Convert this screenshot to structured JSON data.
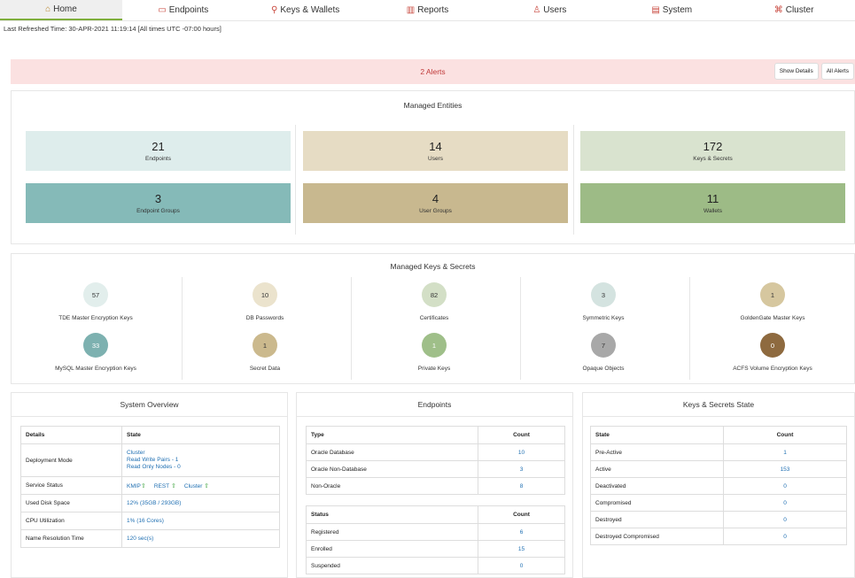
{
  "nav": [
    {
      "icon": "⌂",
      "icon_name": "home-icon",
      "label": "Home",
      "active": true
    },
    {
      "icon": "▭",
      "icon_name": "monitor-icon",
      "label": "Endpoints"
    },
    {
      "icon": "⚲",
      "icon_name": "key-icon",
      "label": "Keys & Wallets"
    },
    {
      "icon": "▥",
      "icon_name": "chart-icon",
      "label": "Reports"
    },
    {
      "icon": "♙",
      "icon_name": "users-icon",
      "label": "Users"
    },
    {
      "icon": "▤",
      "icon_name": "system-icon",
      "label": "System"
    },
    {
      "icon": "⌘",
      "icon_name": "cluster-icon",
      "label": "Cluster"
    }
  ],
  "refresh_text": "Last Refreshed Time: 30-APR-2021 11:19:14 [All times UTC -07:00 hours]",
  "alerts": {
    "text": "2 Alerts",
    "show_details": "Show Details",
    "all_alerts": "All Alerts"
  },
  "entities": {
    "title": "Managed Entities",
    "tiles": [
      {
        "value": "21",
        "label": "Endpoints",
        "color": "#deedec"
      },
      {
        "value": "14",
        "label": "Users",
        "color": "#e6dcc4"
      },
      {
        "value": "172",
        "label": "Keys & Secrets",
        "color": "#d9e3cf"
      },
      {
        "value": "3",
        "label": "Endpoint Groups",
        "color": "#85bab8"
      },
      {
        "value": "4",
        "label": "User Groups",
        "color": "#c8b88f"
      },
      {
        "value": "11",
        "label": "Wallets",
        "color": "#9dbb86"
      }
    ]
  },
  "keys": {
    "title": "Managed Keys & Secrets",
    "items": [
      {
        "value": "57",
        "label": "TDE Master Encryption Keys",
        "color": "#e2eeec",
        "fg": "#333"
      },
      {
        "value": "10",
        "label": "DB Passwords",
        "color": "#ebe3cd",
        "fg": "#333"
      },
      {
        "value": "82",
        "label": "Certificates",
        "color": "#d3dfc6",
        "fg": "#333"
      },
      {
        "value": "3",
        "label": "Symmetric Keys",
        "color": "#d4e3e0",
        "fg": "#333"
      },
      {
        "value": "1",
        "label": "GoldenGate Master Keys",
        "color": "#d6c79f",
        "fg": "#333"
      },
      {
        "value": "33",
        "label": "MySQL Master Encryption Keys",
        "color": "#7db1b0",
        "fg": "#fff"
      },
      {
        "value": "1",
        "label": "Secret Data",
        "color": "#cbb98d",
        "fg": "#333"
      },
      {
        "value": "1",
        "label": "Private Keys",
        "color": "#9fbf89",
        "fg": "#fff"
      },
      {
        "value": "7",
        "label": "Opaque Objects",
        "color": "#a8a8a8",
        "fg": "#333"
      },
      {
        "value": "0",
        "label": "ACFS Volume Encryption Keys",
        "color": "#8e6a3f",
        "fg": "#fff"
      }
    ]
  },
  "system_overview": {
    "title": "System Overview",
    "headers": [
      "Details",
      "State"
    ],
    "deployment_label": "Deployment Mode",
    "deployment_lines": [
      "Cluster",
      "Read Write Pairs - 1",
      "Read Only Nodes - 0"
    ],
    "service_label": "Service Status",
    "services": [
      "KMIP",
      "REST",
      "Cluster"
    ],
    "up_icon": "⇧",
    "disk_label": "Used Disk Space",
    "disk_value": "12% (35GB / 293GB)",
    "cpu_label": "CPU Utilization",
    "cpu_value": "1% (16 Cores)",
    "resolution_label": "Name Resolution Time",
    "resolution_value": "120 sec(s)"
  },
  "endpoints_panel": {
    "title": "Endpoints",
    "type_headers": [
      "Type",
      "Count"
    ],
    "types": [
      {
        "name": "Oracle Database",
        "count": "10"
      },
      {
        "name": "Oracle Non-Database",
        "count": "3"
      },
      {
        "name": "Non-Oracle",
        "count": "8"
      }
    ],
    "status_headers": [
      "Status",
      "Count"
    ],
    "statuses": [
      {
        "name": "Registered",
        "count": "6"
      },
      {
        "name": "Enrolled",
        "count": "15"
      },
      {
        "name": "Suspended",
        "count": "0"
      }
    ]
  },
  "keys_state": {
    "title": "Keys & Secrets State",
    "headers": [
      "State",
      "Count"
    ],
    "rows": [
      {
        "name": "Pre-Active",
        "count": "1"
      },
      {
        "name": "Active",
        "count": "153"
      },
      {
        "name": "Deactivated",
        "count": "0"
      },
      {
        "name": "Compromised",
        "count": "0"
      },
      {
        "name": "Destroyed",
        "count": "0"
      },
      {
        "name": "Destroyed Compromised",
        "count": "0"
      }
    ]
  }
}
